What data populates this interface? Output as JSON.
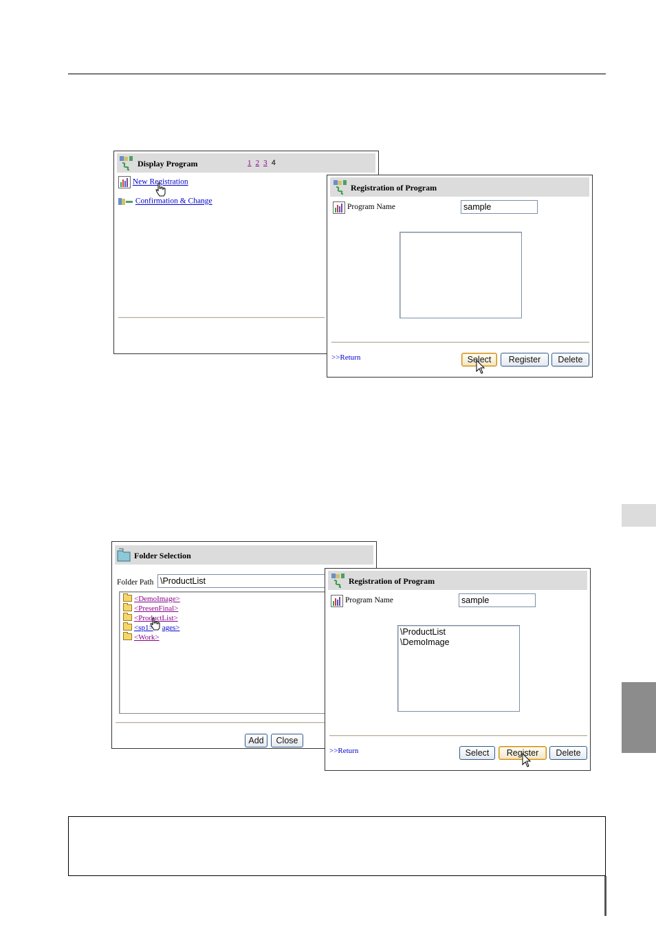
{
  "win1": {
    "title": "Display Program",
    "pages": [
      "1",
      "2",
      "3"
    ],
    "current_page": "4",
    "link_new": "New Registration",
    "link_confirm": "Confirmation & Change"
  },
  "reg1": {
    "title": "Registration of Program",
    "name_label": "Program Name",
    "name_value": "sample",
    "list_items": [],
    "return_label": ">>Return",
    "select_label": "Select",
    "register_label": "Register",
    "delete_label": "Delete"
  },
  "folder": {
    "title": "Folder Selection",
    "path_label": "Folder Path",
    "path_value": "\\ProductList",
    "items": [
      "<DemoImage>",
      "<PresenFinal>",
      "<ProductList>",
      "<sp1>",
      "ages>",
      "<Work>"
    ],
    "add_label": "Add",
    "close_label": "Close"
  },
  "reg2": {
    "title": "Registration of Program",
    "name_label": "Program Name",
    "name_value": "sample",
    "list_items": [
      "\\ProductList",
      "\\DemoImage"
    ],
    "return_label": ">>Return",
    "select_label": "Select",
    "register_label": "Register",
    "delete_label": "Delete"
  },
  "colors": {
    "link": "#0000cc",
    "visited": "#880088",
    "titlebar": "#dcdcdc",
    "tab_dark": "#8c8c8c"
  },
  "icons": [
    "program-icon",
    "chart-icon",
    "folder-icon",
    "hand-cursor-icon",
    "arrow-cursor-icon"
  ]
}
